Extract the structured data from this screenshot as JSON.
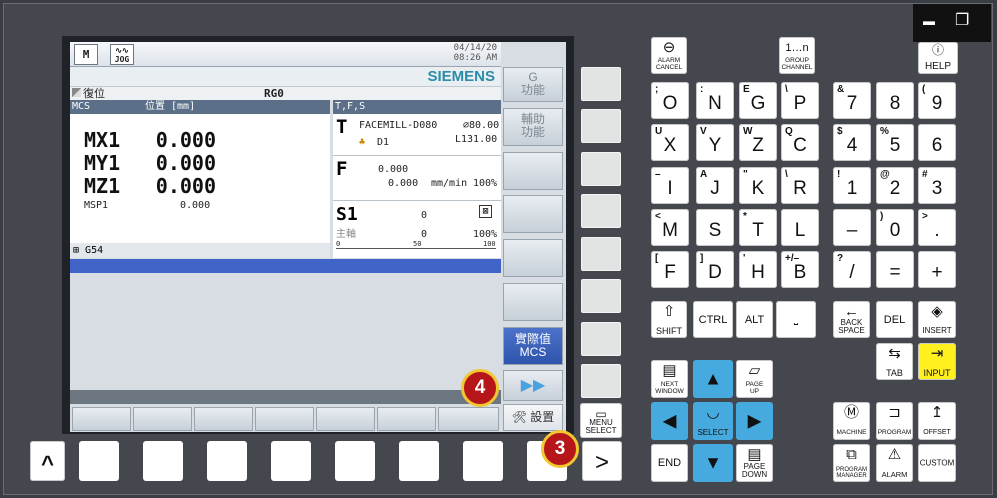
{
  "window_controls": {
    "minimize": "▬",
    "restore": "❐"
  },
  "screen": {
    "mode": "JOG",
    "machine_icon": "M",
    "date": "04/14/20",
    "time": "08:26 AM",
    "brand": "SIEMENS",
    "status_reset": "復位",
    "status_channel": "RG0",
    "position_header": "MCS",
    "position_unit": "位置 [mm]",
    "axes": [
      {
        "name": "MX1",
        "value": "0.000"
      },
      {
        "name": "MY1",
        "value": "0.000"
      },
      {
        "name": "MZ1",
        "value": "0.000"
      }
    ],
    "spindle_pos": {
      "name": "MSP1",
      "value": "0.000"
    },
    "work_offset": "G54",
    "tfs_header": "T,F,S",
    "tool": {
      "letter": "T",
      "name": "FACEMILL-D080",
      "diameter": "⌀80.00",
      "length": "L131.00",
      "d": "D1"
    },
    "feed": {
      "letter": "F",
      "value1": "0.000",
      "value2": "0.000",
      "unit": "mm/min",
      "percent": "100%"
    },
    "spindle": {
      "letter": "S1",
      "value": "0",
      "label": "主軸",
      "actual": "0",
      "percent": "100%",
      "scale_min": "0",
      "scale_mid": "50",
      "scale_max": "100"
    },
    "softkeys": [
      "G\n功能",
      "輔助\n功能",
      "",
      "",
      "",
      "",
      "實際值\nMCS"
    ],
    "more": "▶▶",
    "settings": "設置"
  },
  "panel": {
    "alarm_cancel": "ALARM\nCANCEL",
    "group_channel": "GROUP\nCHANNEL",
    "help": "HELP",
    "menu_select": "MENU\nSELECT",
    "letter_keys": [
      {
        "main": "O",
        "sub": ";"
      },
      {
        "main": "N",
        "sub": ":"
      },
      {
        "main": "G",
        "sub": "E"
      },
      {
        "main": "P",
        "sub": "\\"
      },
      {
        "main": "X",
        "sub": "U"
      },
      {
        "main": "Y",
        "sub": "V"
      },
      {
        "main": "Z",
        "sub": "W"
      },
      {
        "main": "C",
        "sub": "Q"
      },
      {
        "main": "I",
        "sub": "–"
      },
      {
        "main": "J",
        "sub": "A"
      },
      {
        "main": "K",
        "sub": "\""
      },
      {
        "main": "R",
        "sub": "\\"
      },
      {
        "main": "M",
        "sub": "<"
      },
      {
        "main": "S",
        "sub": ""
      },
      {
        "main": "T",
        "sub": "*"
      },
      {
        "main": "L",
        "sub": ""
      },
      {
        "main": "F",
        "sub": "["
      },
      {
        "main": "D",
        "sub": "]"
      },
      {
        "main": "H",
        "sub": "'"
      },
      {
        "main": "B",
        "sub": "+/–"
      }
    ],
    "num_keys": [
      {
        "main": "7",
        "sub": "&"
      },
      {
        "main": "8",
        "sub": ""
      },
      {
        "main": "9",
        "sub": "("
      },
      {
        "main": "4",
        "sub": "$"
      },
      {
        "main": "5",
        "sub": "%"
      },
      {
        "main": "6",
        "sub": ""
      },
      {
        "main": "1",
        "sub": "!"
      },
      {
        "main": "2",
        "sub": "@"
      },
      {
        "main": "3",
        "sub": "#"
      },
      {
        "main": "–",
        "sub": ""
      },
      {
        "main": "0",
        "sub": ")"
      },
      {
        "main": ".",
        "sub": ">"
      },
      {
        "main": "/",
        "sub": "?"
      },
      {
        "main": "=",
        "sub": ""
      },
      {
        "main": "+",
        "sub": ""
      }
    ],
    "shift": "SHIFT",
    "ctrl": "CTRL",
    "alt": "ALT",
    "backspace": "BACK\nSPACE",
    "del": "DEL",
    "insert": "INSERT",
    "tab": "TAB",
    "input": "INPUT",
    "next_window": "NEXT\nWINDOW",
    "page_up": "PAGE\nUP",
    "select": "SELECT",
    "end": "END",
    "page_down": "PAGE\nDOWN",
    "machine": "MACHINE",
    "program": "PROGRAM",
    "offset": "OFFSET",
    "program_manager": "PROGRAM\nMANAGER",
    "alarm": "ALARM",
    "custom": "CUSTOM",
    "caret": "^",
    "next": ">"
  },
  "callouts": [
    "4",
    "3"
  ],
  "colors": {
    "callout_fill": "#b6161a",
    "callout_ring": "#f2c730",
    "siemens": "#2d8ca8",
    "blue_key": "#47aadf",
    "yellow_key": "#fff01e"
  }
}
